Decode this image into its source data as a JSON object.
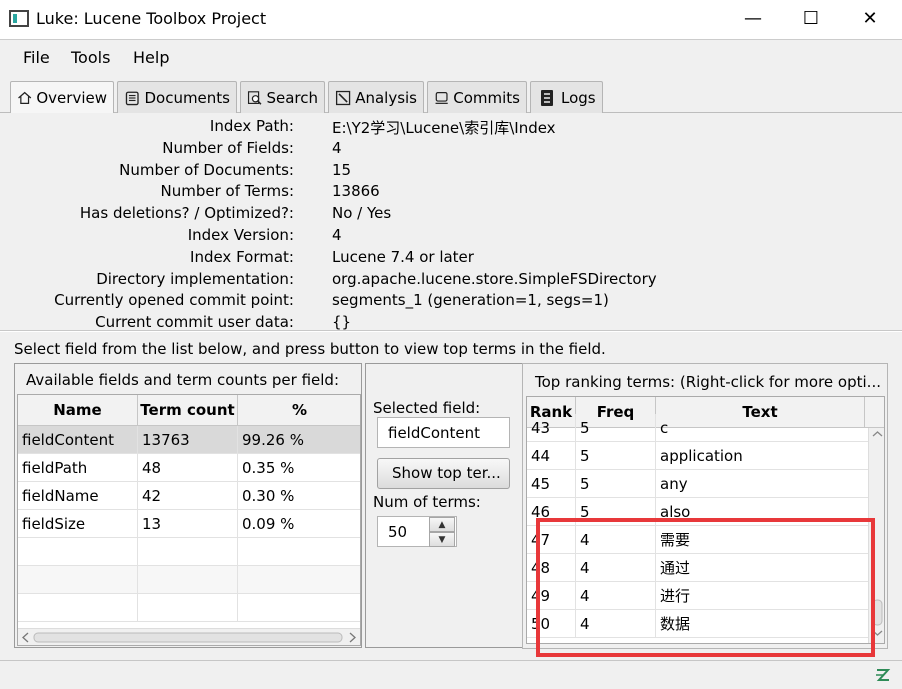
{
  "window": {
    "title": "Luke: Lucene Toolbox Project",
    "controls": {
      "minimize": "—",
      "maximize": "☐",
      "close": "✕"
    }
  },
  "menu": [
    "File",
    "Tools",
    "Help"
  ],
  "tabs": [
    {
      "label": "Overview",
      "icon": "home-icon",
      "active": true
    },
    {
      "label": "Documents",
      "icon": "documents-icon",
      "active": false
    },
    {
      "label": "Search",
      "icon": "search-icon",
      "active": false
    },
    {
      "label": "Analysis",
      "icon": "analysis-icon",
      "active": false
    },
    {
      "label": "Commits",
      "icon": "commits-icon",
      "active": false
    },
    {
      "label": "Logs",
      "icon": "logs-icon",
      "active": false
    }
  ],
  "overview": [
    {
      "label": "Index Path:",
      "value": "E:\\Y2学习\\Lucene\\索引库\\Index"
    },
    {
      "label": "Number of Fields:",
      "value": "4"
    },
    {
      "label": "Number of Documents:",
      "value": "15"
    },
    {
      "label": "Number of Terms:",
      "value": "13866"
    },
    {
      "label": "Has deletions? / Optimized?:",
      "value": "No / Yes"
    },
    {
      "label": "Index Version:",
      "value": "4"
    },
    {
      "label": "Index Format:",
      "value": "Lucene 7.4 or later"
    },
    {
      "label": "Directory implementation:",
      "value": "org.apache.lucene.store.SimpleFSDirectory"
    },
    {
      "label": "Currently opened commit point:",
      "value": "segments_1 (generation=1, segs=1)"
    },
    {
      "label": "Current commit user data:",
      "value": "{}"
    }
  ],
  "instructions": "Select field from the list below, and press button to view top terms in the field.",
  "fields_panel": {
    "title": "Available fields and term counts per field:",
    "columns": [
      "Name",
      "Term count",
      "%"
    ],
    "rows": [
      [
        "fieldContent",
        "13763",
        "99.26 %"
      ],
      [
        "fieldPath",
        "48",
        "0.35 %"
      ],
      [
        "fieldName",
        "42",
        "0.30 %"
      ],
      [
        "fieldSize",
        "13",
        "0.09 %"
      ]
    ],
    "selected_row": 0
  },
  "controls_panel": {
    "selected_field_label": "Selected field:",
    "selected_field_value": "fieldContent",
    "show_button": "Show top ter...",
    "num_terms_label": "Num of terms:",
    "num_terms_value": "50"
  },
  "terms_panel": {
    "title": "Top ranking terms: (Right-click for more opti...",
    "columns": [
      "Rank",
      "Freq",
      "Text"
    ],
    "rows": [
      [
        "43",
        "5",
        "c"
      ],
      [
        "44",
        "5",
        "application"
      ],
      [
        "45",
        "5",
        "any"
      ],
      [
        "46",
        "5",
        "also"
      ],
      [
        "47",
        "4",
        "需要"
      ],
      [
        "48",
        "4",
        "通过"
      ],
      [
        "49",
        "4",
        "进行"
      ],
      [
        "50",
        "4",
        "数据"
      ]
    ]
  },
  "colors": {
    "highlight": "#e8383a",
    "status_icon": "#2e8b57"
  }
}
